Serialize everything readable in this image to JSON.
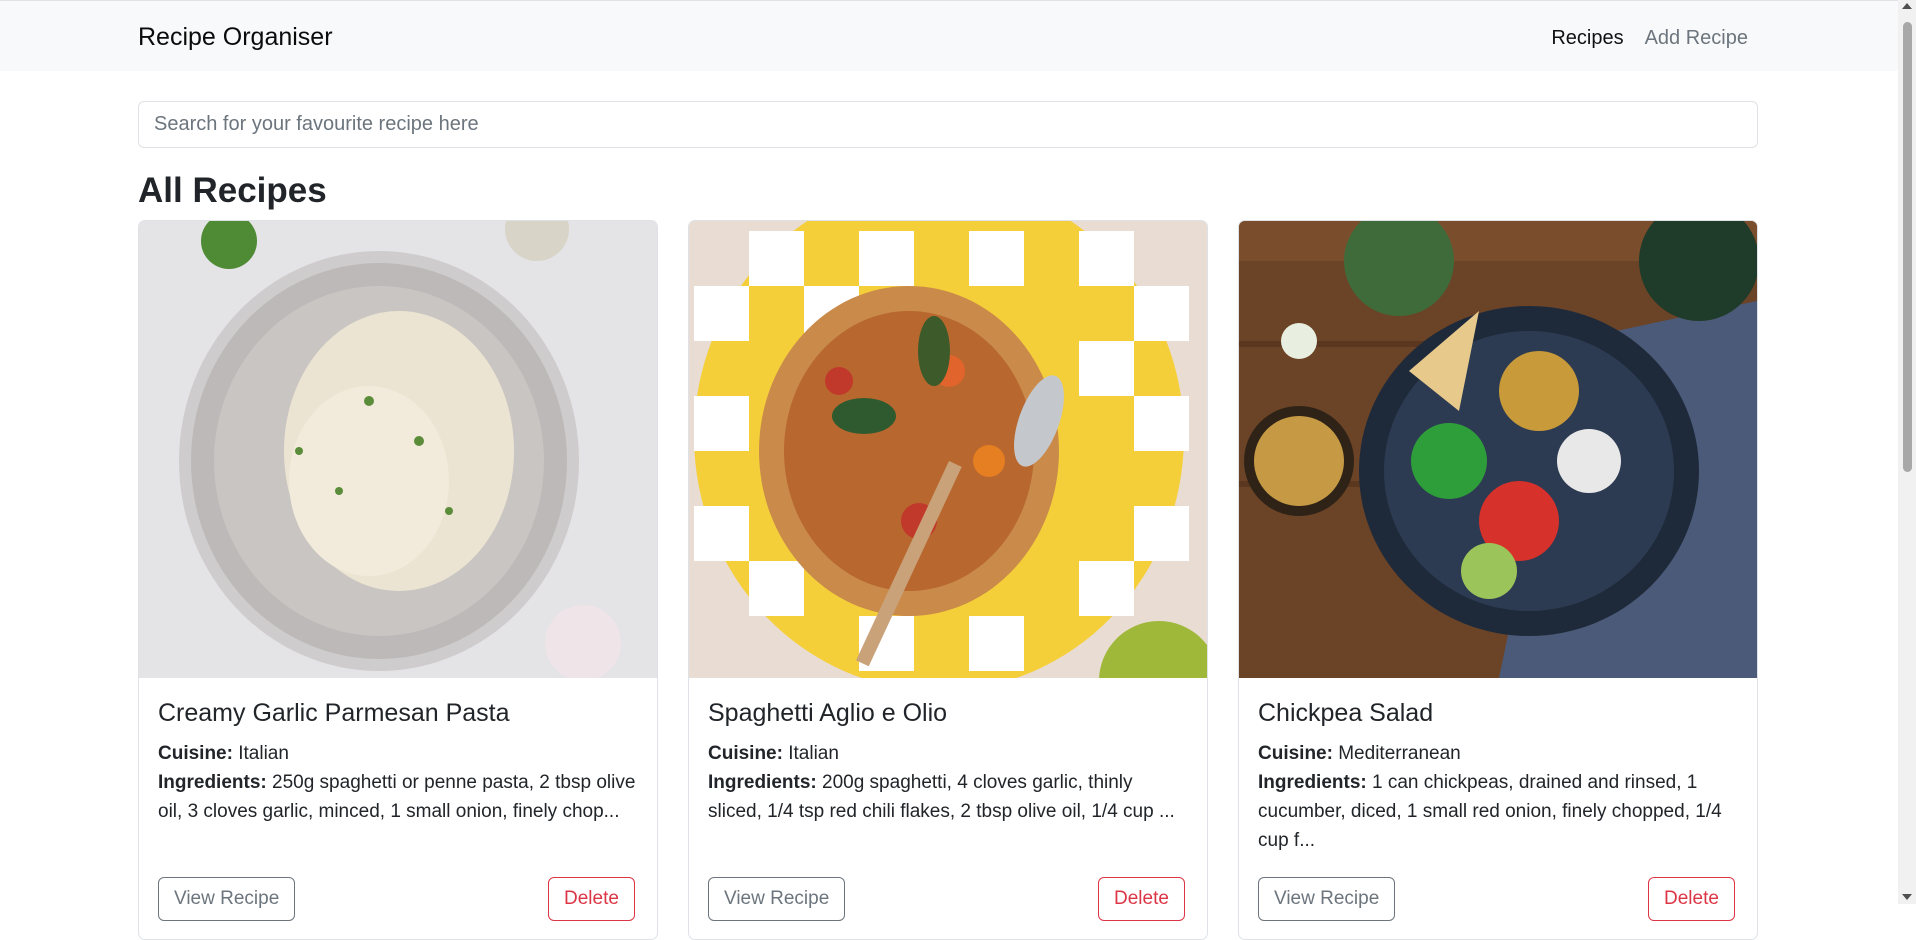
{
  "navbar": {
    "brand": "Recipe Organiser",
    "links": [
      {
        "label": "Recipes",
        "active": true
      },
      {
        "label": "Add Recipe",
        "active": false
      }
    ]
  },
  "search": {
    "placeholder": "Search for your favourite recipe here",
    "value": ""
  },
  "section_title": "All Recipes",
  "recipes": [
    {
      "title": "Creamy Garlic Parmesan Pasta",
      "cuisine_label": "Cuisine:",
      "cuisine": "Italian",
      "ingredients_label": "Ingredients:",
      "ingredients": "250g spaghetti or penne pasta, 2 tbsp olive oil, 3 cloves garlic, minced, 1 small onion, finely chop...",
      "view_label": "View Recipe",
      "delete_label": "Delete"
    },
    {
      "title": "Spaghetti Aglio e Olio",
      "cuisine_label": "Cuisine:",
      "cuisine": "Italian",
      "ingredients_label": "Ingredients:",
      "ingredients": "200g spaghetti, 4 cloves garlic, thinly sliced, 1/4 tsp red chili flakes, 2 tbsp olive oil, 1/4 cup ...",
      "view_label": "View Recipe",
      "delete_label": "Delete"
    },
    {
      "title": "Chickpea Salad",
      "cuisine_label": "Cuisine:",
      "cuisine": "Mediterranean",
      "ingredients_label": "Ingredients:",
      "ingredients": "1 can chickpeas, drained and rinsed, 1 cucumber, diced, 1 small red onion, finely chopped, 1/4 cup f...",
      "view_label": "View Recipe",
      "delete_label": "Delete"
    }
  ],
  "colors": {
    "navbar_bg": "#f8f9fa",
    "secondary": "#6c757d",
    "danger": "#dc3545",
    "border": "#dee2e6"
  }
}
